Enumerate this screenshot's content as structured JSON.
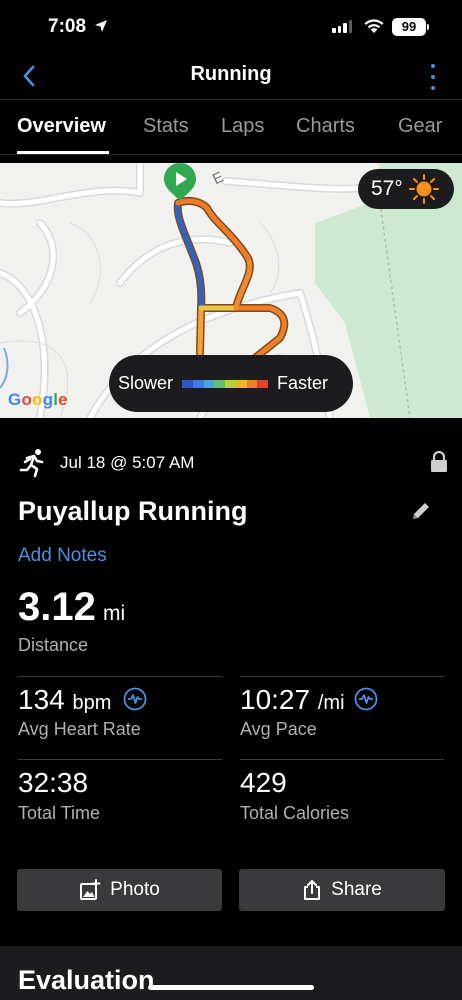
{
  "status_bar": {
    "time": "7:08",
    "battery": "99"
  },
  "nav": {
    "title": "Running",
    "back_icon": "chevron-left-icon",
    "more_icon": "more-vertical-icon"
  },
  "tabs": [
    {
      "label": "Overview",
      "active": true
    },
    {
      "label": "Stats",
      "active": false
    },
    {
      "label": "Laps",
      "active": false
    },
    {
      "label": "Charts",
      "active": false
    },
    {
      "label": "Gear",
      "active": false
    }
  ],
  "map": {
    "weather_temp": "57°",
    "weather_icon": "sun-icon",
    "legend_slower": "Slower",
    "legend_faster": "Faster",
    "legend_colors": [
      "#2b59c3",
      "#3d7be0",
      "#4ea3e8",
      "#5fbf6a",
      "#b6d33a",
      "#f0b42a",
      "#f07d28",
      "#e0452b"
    ],
    "attribution": "Google"
  },
  "activity": {
    "date": "Jul 18 @ 5:07 AM",
    "title": "Puyallup Running",
    "add_notes": "Add Notes",
    "distance_value": "3.12",
    "distance_unit": "mi",
    "distance_label": "Distance",
    "stats": {
      "heart_rate": {
        "value": "134",
        "unit": "bpm",
        "label": "Avg Heart Rate"
      },
      "pace": {
        "value": "10:27",
        "unit": "/mi",
        "label": "Avg Pace"
      },
      "time": {
        "value": "32:38",
        "label": "Total Time"
      },
      "calories": {
        "value": "429",
        "label": "Total Calories"
      }
    }
  },
  "actions": {
    "photo_label": "Photo",
    "share_label": "Share"
  },
  "evaluation": {
    "title": "Evaluation"
  },
  "colors": {
    "accent": "#4a90e2",
    "background": "#000000",
    "button": "#3a3a3c"
  }
}
